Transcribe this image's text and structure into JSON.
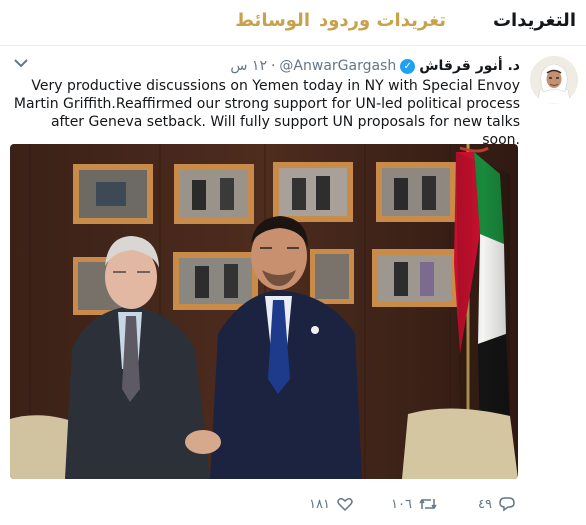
{
  "tabs": [
    {
      "label": "التغريدات",
      "active": true
    },
    {
      "label": "تغريدات وردود",
      "active": false
    },
    {
      "label": "الوسائط",
      "active": false
    }
  ],
  "tweet": {
    "author_name": "د. أنور قرقاش",
    "verified": true,
    "handle": "@AnwarGargash",
    "separator": "·",
    "time": "١٢ س",
    "text": "Very productive discussions on Yemen today in NY with Special Envoy Martin Griffith.Reaffirmed our strong support for UN-led political process after Geneva setback. Will fully support UN proposals for new talks soon.",
    "actions": {
      "reply_count": "٤٩",
      "retweet_count": "١٠٦",
      "like_count": "١٨١"
    }
  },
  "icons": {
    "verified": "verified-badge-icon",
    "caret": "chevron-down-icon",
    "reply": "reply-icon",
    "retweet": "retweet-icon",
    "like": "heart-icon"
  },
  "colors": {
    "accent": "#c8a24a",
    "verified": "#1da1f2",
    "muted": "#657786",
    "text": "#14171a"
  }
}
